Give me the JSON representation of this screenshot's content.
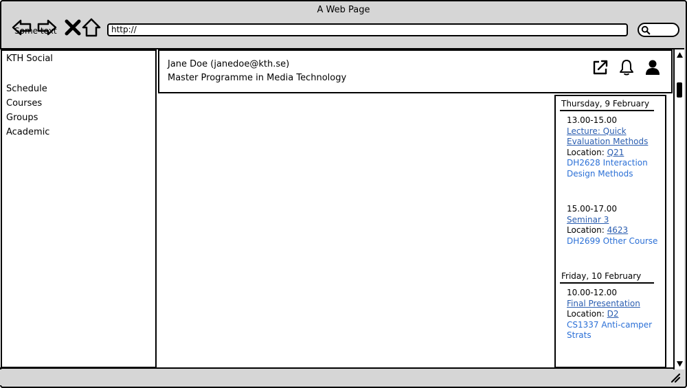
{
  "window": {
    "title": "A Web Page",
    "overlay_text": "Some text",
    "url": "http://"
  },
  "sidebar": {
    "brand": "KTH Social",
    "items": [
      {
        "label": "Schedule"
      },
      {
        "label": "Courses"
      },
      {
        "label": "Groups"
      },
      {
        "label": "Academic"
      }
    ]
  },
  "profile": {
    "name_line": "Jane Doe (janedoe@kth.se)",
    "programme": "Master Programme in Media Technology",
    "icons": [
      "external-link-icon",
      "bell-icon",
      "user-icon"
    ]
  },
  "schedule": {
    "days": [
      {
        "date": "Thursday, 9 February",
        "events": [
          {
            "time": "13.00-15.00",
            "title": "Lecture: Quick Evaluation Methods",
            "location_label": "Location: ",
            "location": "Q21",
            "course": "DH2628 Interaction Design Methods"
          },
          {
            "time": "15.00-17.00",
            "title": "Seminar 3",
            "location_label": "Location: ",
            "location": "4623",
            "course": "DH2699 Other Course"
          }
        ]
      },
      {
        "date": "Friday, 10 February",
        "events": [
          {
            "time": "10.00-12.00",
            "title": "Final Presentation",
            "location_label": "Location: ",
            "location": "D2",
            "course": "CS1337 Anti-camper Strats"
          }
        ]
      }
    ]
  },
  "colors": {
    "link": "#2a5db0",
    "course": "#2a6fd6",
    "chrome": "#d6d6d6"
  }
}
